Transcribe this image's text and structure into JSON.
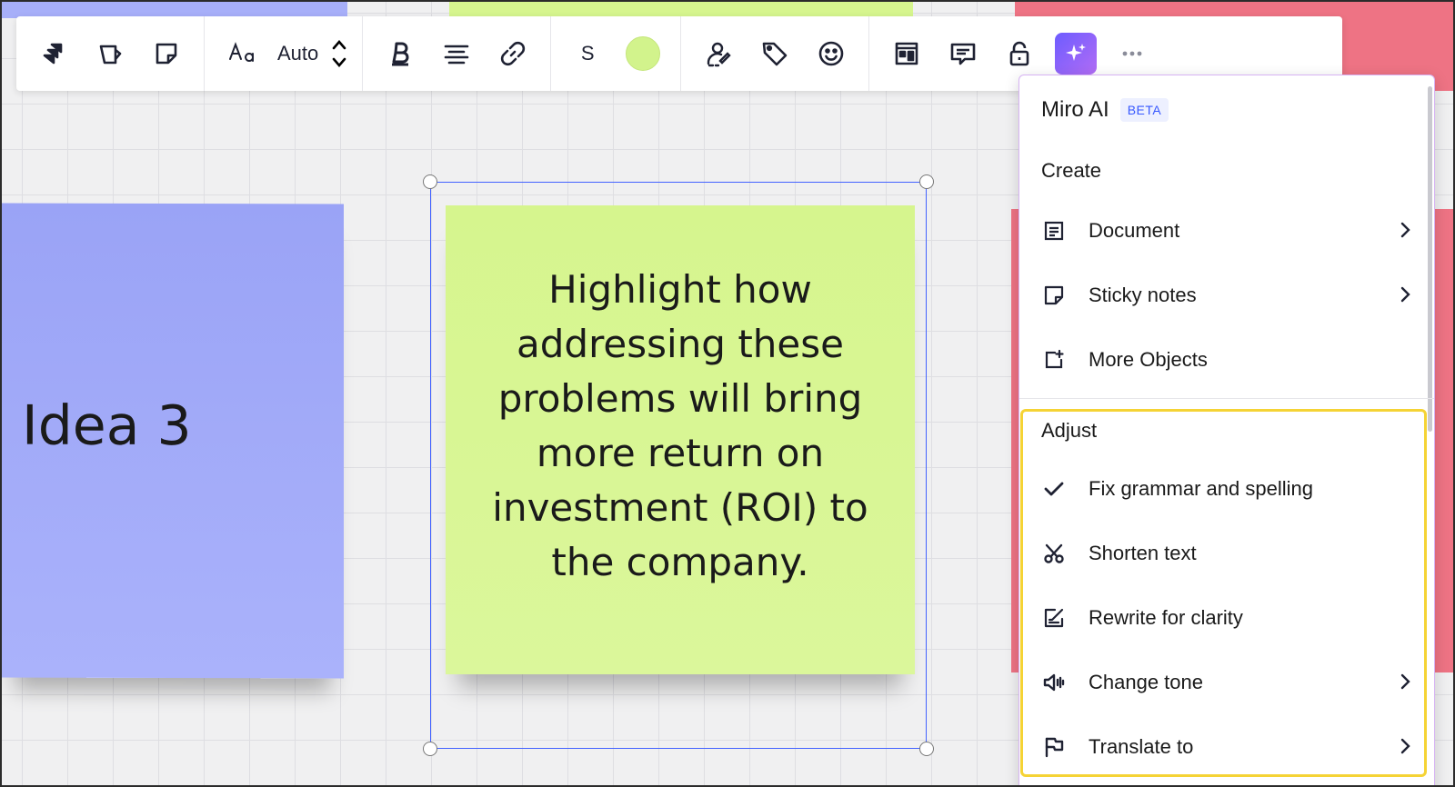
{
  "toolbar": {
    "font_size_label": "Auto",
    "sticky_size_label": "S",
    "colors": {
      "sticky_color": "#d2f38c",
      "ai_button_gradient_start": "#6d5cff",
      "ai_button_gradient_end": "#b26cf5"
    },
    "icons": [
      "switch-type-icon",
      "shape-icon",
      "sticky-note-icon",
      "text-style-icon",
      "stepper-icon",
      "bold-icon",
      "align-center-icon",
      "link-icon",
      "color-icon",
      "assign-icon",
      "tag-icon",
      "emoji-icon",
      "kanban-icon",
      "comment-icon",
      "lock-icon",
      "ai-sparkle-icon",
      "more-icon"
    ]
  },
  "canvas": {
    "sticky_blue": {
      "text": "Idea 3",
      "color": "#9aa3f6"
    },
    "sticky_green": {
      "text": "Highlight how addressing these problems will bring more return on investment (ROI) to the company.",
      "color": "#d6f58e"
    },
    "selection_color": "#4262ff"
  },
  "ai_menu": {
    "title": "Miro AI",
    "badge": "BETA",
    "create_section": {
      "label": "Create",
      "items": [
        {
          "label": "Document",
          "icon": "document-icon",
          "has_submenu": true
        },
        {
          "label": "Sticky notes",
          "icon": "sticky-note-icon",
          "has_submenu": true
        },
        {
          "label": "More Objects",
          "icon": "add-object-icon",
          "has_submenu": false
        }
      ]
    },
    "adjust_section": {
      "label": "Adjust",
      "highlight_color": "#f5d335",
      "items": [
        {
          "label": "Fix grammar and spelling",
          "icon": "checkmark-icon",
          "has_submenu": false
        },
        {
          "label": "Shorten text",
          "icon": "scissors-icon",
          "has_submenu": false
        },
        {
          "label": "Rewrite for clarity",
          "icon": "rewrite-icon",
          "has_submenu": false
        },
        {
          "label": "Change tone",
          "icon": "speaker-icon",
          "has_submenu": true
        },
        {
          "label": "Translate to",
          "icon": "flag-icon",
          "has_submenu": true
        }
      ]
    }
  }
}
